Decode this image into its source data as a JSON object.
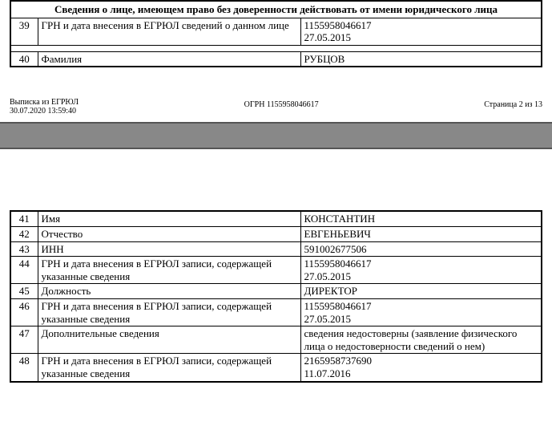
{
  "section_header": "Сведения о лице, имеющем право без доверенности действовать от имени юридического лица",
  "rows_page1": [
    {
      "num": "39",
      "label": "ГРН и дата внесения в ЕГРЮЛ сведений о данном лице",
      "value": "1155958046617\n27.05.2015"
    },
    {
      "num": "40",
      "label": "Фамилия",
      "value": "РУБЦОВ"
    }
  ],
  "rows_page2": [
    {
      "num": "41",
      "label": "Имя",
      "value": "КОНСТАНТИН"
    },
    {
      "num": "42",
      "label": "Отчество",
      "value": "ЕВГЕНЬЕВИЧ"
    },
    {
      "num": "43",
      "label": "ИНН",
      "value": "591002677506"
    },
    {
      "num": "44",
      "label": "ГРН и дата внесения в ЕГРЮЛ записи, содержащей указанные сведения",
      "value": "1155958046617\n27.05.2015"
    },
    {
      "num": "45",
      "label": "Должность",
      "value": "ДИРЕКТОР"
    },
    {
      "num": "46",
      "label": "ГРН и дата внесения в ЕГРЮЛ записи, содержащей указанные сведения",
      "value": "1155958046617\n27.05.2015"
    },
    {
      "num": "47",
      "label": "Дополнительные сведения",
      "value": "сведения недостоверны (заявление физического лица о недостоверности сведений о нем)"
    },
    {
      "num": "48",
      "label": "ГРН и дата внесения в ЕГРЮЛ записи, содержащей указанные сведения",
      "value": "2165958737690\n11.07.2016"
    }
  ],
  "footer": {
    "left_line1": "Выписка из ЕГРЮЛ",
    "left_line2": "30.07.2020 13:59:40",
    "center": "ОГРН 1155958046617",
    "right": "Страница 2 из 13"
  }
}
